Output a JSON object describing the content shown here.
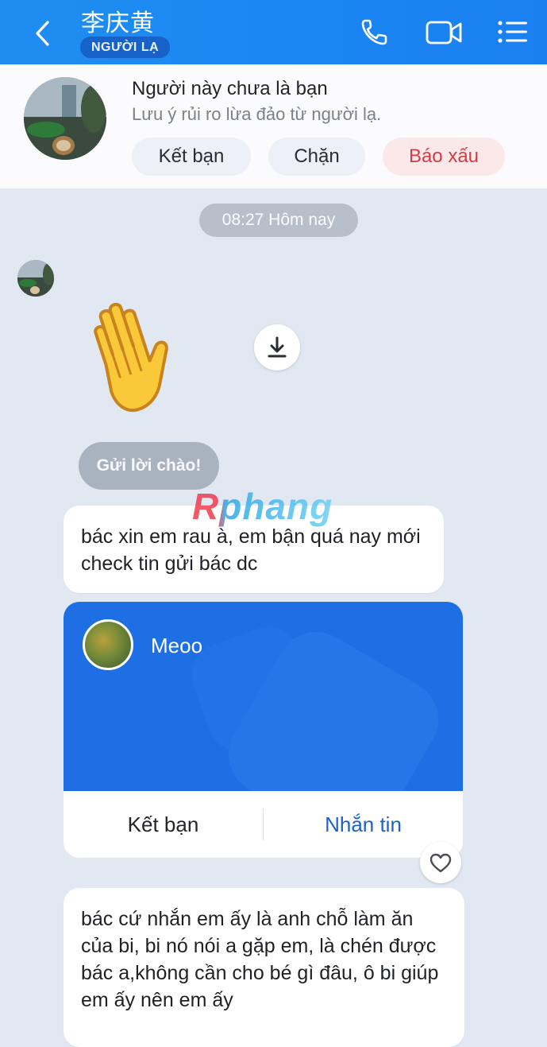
{
  "header": {
    "contact_name": "李庆黄",
    "stranger_badge": "NGƯỜI LẠ",
    "back_icon": "chevron-left-icon",
    "call_icon": "phone-icon",
    "video_icon": "video-camera-icon",
    "menu_icon": "list-menu-icon"
  },
  "banner": {
    "title": "Người này chưa là bạn",
    "subtitle": "Lưu ý rủi ro lừa đảo từ người lạ.",
    "add_friend": "Kết bạn",
    "block": "Chặn",
    "report": "Báo xấu"
  },
  "chat": {
    "timestamp": "08:27 Hôm nay",
    "sticker": "waving-hand",
    "download_icon": "download-icon",
    "greeting": "Gửi lời chào!",
    "watermark": "Rphang",
    "message1": "bác xin em rau à, em bận quá nay mới check tin gửi bác dc",
    "card": {
      "name": "Meoo",
      "add_friend": "Kết bạn",
      "send_message": "Nhắn tin"
    },
    "heart_icon": "heart-icon",
    "message2": "bác cứ nhắn em ấy là anh chỗ làm ăn của bi, bi nó nói a gặp em, là chén được bác a,không cần cho bé gì đâu,  ô bi giúp em ấy nên em ấy"
  },
  "colors": {
    "header_blue": "#1f8df0",
    "card_blue": "#1f6fe4",
    "report_red": "#d83a45",
    "link_blue": "#1b63c8"
  }
}
